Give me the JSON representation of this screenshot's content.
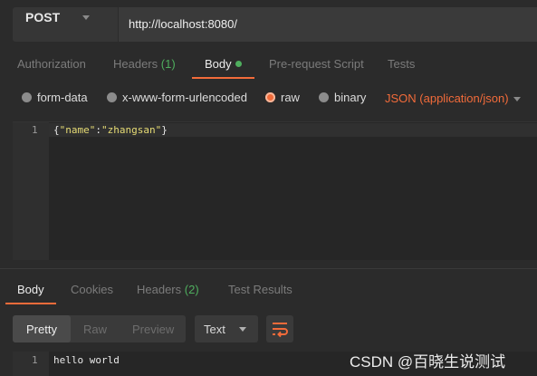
{
  "request": {
    "method": "POST",
    "url": "http://localhost:8080/"
  },
  "request_tabs": {
    "authorization": "Authorization",
    "headers": "Headers",
    "headers_count": "(1)",
    "body": "Body",
    "prerequest": "Pre-request Script",
    "tests": "Tests"
  },
  "body_types": {
    "form_data": "form-data",
    "urlencoded": "x-www-form-urlencoded",
    "raw": "raw",
    "binary": "binary",
    "selected": "raw",
    "content_type": "JSON (application/json)"
  },
  "request_editor": {
    "line_number": "1",
    "open_brace": "{",
    "key": "\"name\"",
    "colon": ":",
    "value": "\"zhangsan\"",
    "close_brace": "}"
  },
  "response_tabs": {
    "body": "Body",
    "cookies": "Cookies",
    "headers": "Headers",
    "headers_count": "(2)",
    "test_results": "Test Results"
  },
  "response_toolbar": {
    "pretty": "Pretty",
    "raw": "Raw",
    "preview": "Preview",
    "format": "Text"
  },
  "response_editor": {
    "line_number": "1",
    "content": "hello world"
  },
  "watermark": "CSDN @百晓生说测试",
  "colors": {
    "accent": "#f26b3a",
    "count_green": "#4fae5e",
    "json_string": "#e6db74"
  }
}
